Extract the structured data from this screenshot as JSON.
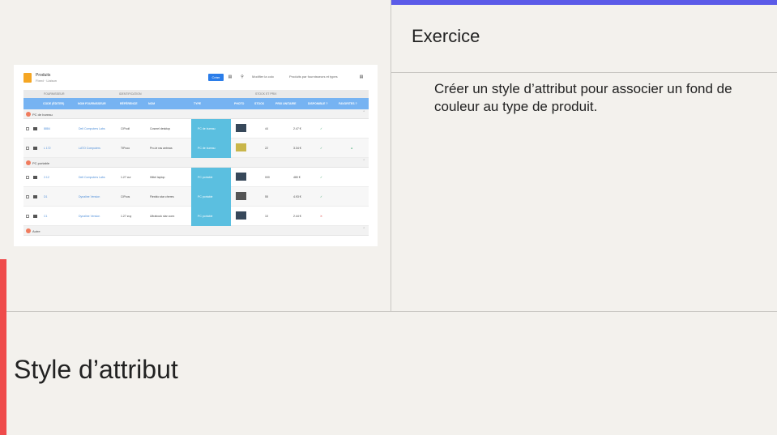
{
  "slide": {
    "exercise_label": "Exercice",
    "exercise_text": "Créer un style d’attribut pour associer un fond de couleur au type de produit.",
    "title": "Style d’attribut"
  },
  "colors": {
    "background": "#f3f1ed",
    "accent_blue": "#5b5be8",
    "accent_red": "#ef4b4b",
    "type_cell": "#5bbfe0",
    "header_blue": "#76b3f2"
  },
  "screenshot": {
    "app_title": "Produits",
    "app_subtitle": "Fixed · Liaison",
    "create_label": "Créer",
    "toolbar_link1": "Modifier la colo",
    "toolbar_link2": "Produits par fournisseurs et types",
    "groups": [
      "FOURNISSEUR",
      "IDENTIFICATION",
      "STOCK ET PRIX"
    ],
    "columns": [
      "CODE (ÉDITER)",
      "NOM FOURNISSEUR",
      "RÉFÉRENCE",
      "NOM",
      "TYPE",
      "PHOTO",
      "STOCK",
      "PRIX UNITAIRE",
      "DISPONIBLE ?",
      "FAVORITES ?"
    ],
    "sections": [
      {
        "label": "PC de bureau",
        "rows": [
          {
            "code": "8884",
            "supplier": "Dell Computers Labs",
            "ref": "CIPcoll",
            "name": "Cosmel desktop",
            "type": "PC de bureau",
            "stock": "44",
            "price": "2.47 €",
            "available": "✓",
            "fav": ""
          },
          {
            "code": "L 172",
            "supplier": "LATO Computers",
            "ref": "TIPcoo",
            "name": "Pro-le ras antmas",
            "type": "PC de bureau",
            "stock": "22",
            "price": "3.34 €",
            "available": "✓",
            "fav": "●"
          }
        ]
      },
      {
        "label": "PC portable",
        "rows": [
          {
            "code": "2.12",
            "supplier": "Dell Computers Labs",
            "ref": "1.27 cur",
            "name": "Hittel laptop",
            "type": "PC portable",
            "stock": "000",
            "price": "480 €",
            "available": "✓",
            "fav": ""
          },
          {
            "code": "D1",
            "supplier": "Dynaline Version",
            "ref": "CIPcos",
            "name": "Flexblo star cheres",
            "type": "PC portable",
            "stock": "55",
            "price": "4.93 €",
            "available": "✓",
            "fav": ""
          },
          {
            "code": "C1",
            "supplier": "Dynaline Version",
            "ref": "1.27 zuy",
            "name": "Ultrabook star conn",
            "type": "PC portable",
            "stock": "10",
            "price": "2.44 €",
            "available": "✕",
            "fav": ""
          }
        ]
      },
      {
        "label": "Autre",
        "rows": []
      }
    ]
  }
}
